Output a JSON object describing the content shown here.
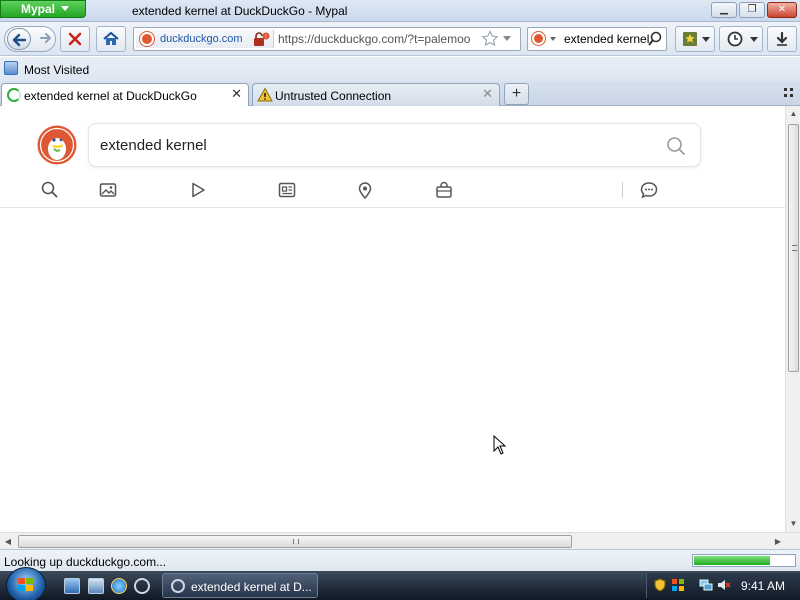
{
  "window": {
    "app_menu_label": "Mypal",
    "title": "extended kernel at DuckDuckGo - Mypal"
  },
  "navbar": {
    "site_identity": "duckduckgo.com",
    "url": "https://duckduckgo.com/?t=palemoo",
    "search_value": "extended kernel"
  },
  "bookmarks_toolbar": {
    "items": [
      {
        "label": "Most Visited",
        "icon": "most-visited-icon"
      }
    ]
  },
  "tabs": [
    {
      "label": "extended kernel at DuckDuckGo",
      "state": "loading",
      "active": true
    },
    {
      "label": "Untrusted Connection",
      "icon": "warning-icon",
      "active": false
    }
  ],
  "page": {
    "search_query": "extended kernel",
    "vertical_tabs": [
      "search-icon",
      "images-icon",
      "videos-icon",
      "news-icon",
      "maps-icon",
      "shopping-icon",
      "chat-icon"
    ]
  },
  "statusbar": {
    "text": "Looking up duckduckgo.com...",
    "progress": 0.76
  },
  "taskbar": {
    "task_label": "extended kernel at D...",
    "clock": "9:41 AM"
  },
  "colors": {
    "ddg_orange": "#de5833",
    "app_menu_green": "#22a522",
    "taskbar_dark": "#0f1823"
  }
}
